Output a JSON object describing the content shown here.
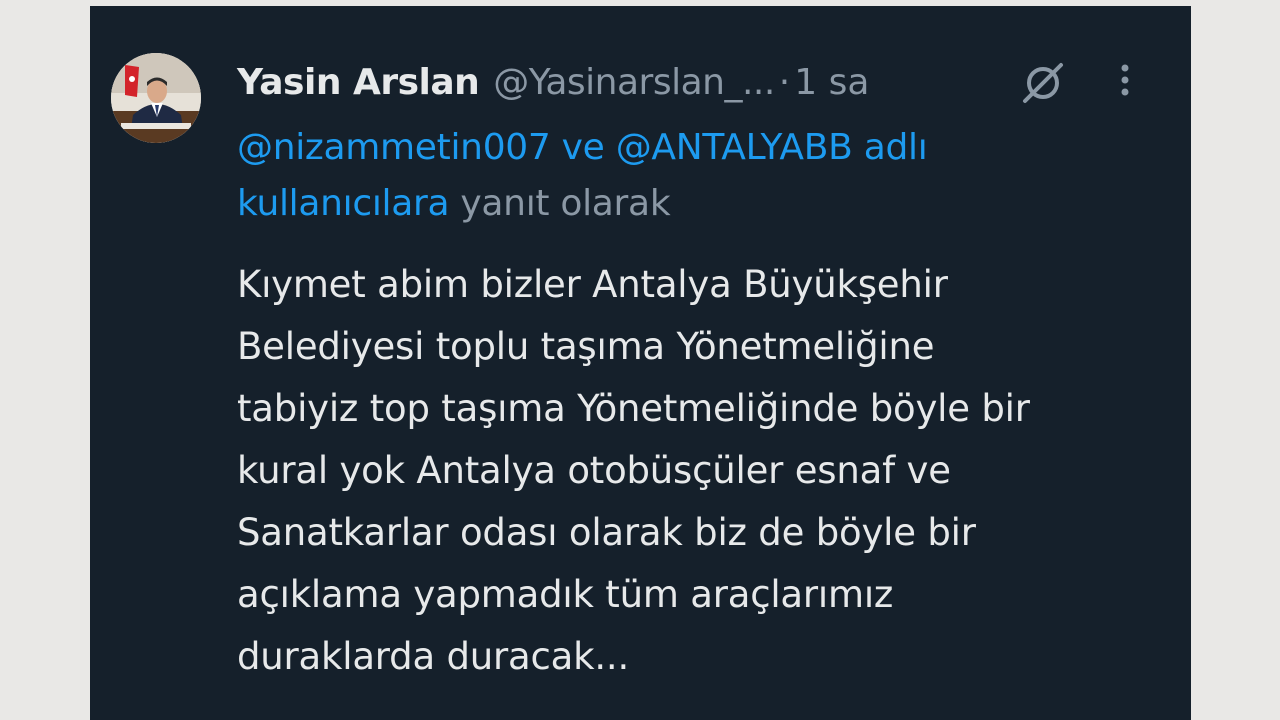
{
  "tweet": {
    "display_name": "Yasin Arslan",
    "handle": "@Yasinarslan_...",
    "separator": "·",
    "time": "1 sa",
    "reply_to": {
      "mention_1": "@nizammetin007",
      "connector": "ve",
      "mention_2": "@ANTALYABB",
      "suffix_link": "adlı kullanıcılara",
      "suffix_text": "yanıt olarak"
    },
    "body_lines": [
      "Kıymet abim bizler Antalya Büyükşehir",
      "Belediyesi toplu taşıma Yönetmeliğine",
      "tabiyiz top taşıma Yönetmeliğinde böyle bir",
      "kural yok Antalya otobüsçüler esnaf ve",
      "Sanatkarlar odası olarak biz de böyle bir",
      "açıklama yapmadık tüm araçlarımız",
      "duraklarda duracak..."
    ]
  },
  "icons": {
    "grok": "grok-icon",
    "more": "more-vertical-icon",
    "avatar": "profile-avatar"
  },
  "colors": {
    "background": "#15202b",
    "link": "#1d9bf0",
    "primary_text": "#e7e9ea",
    "secondary_text": "#8b98a5"
  }
}
